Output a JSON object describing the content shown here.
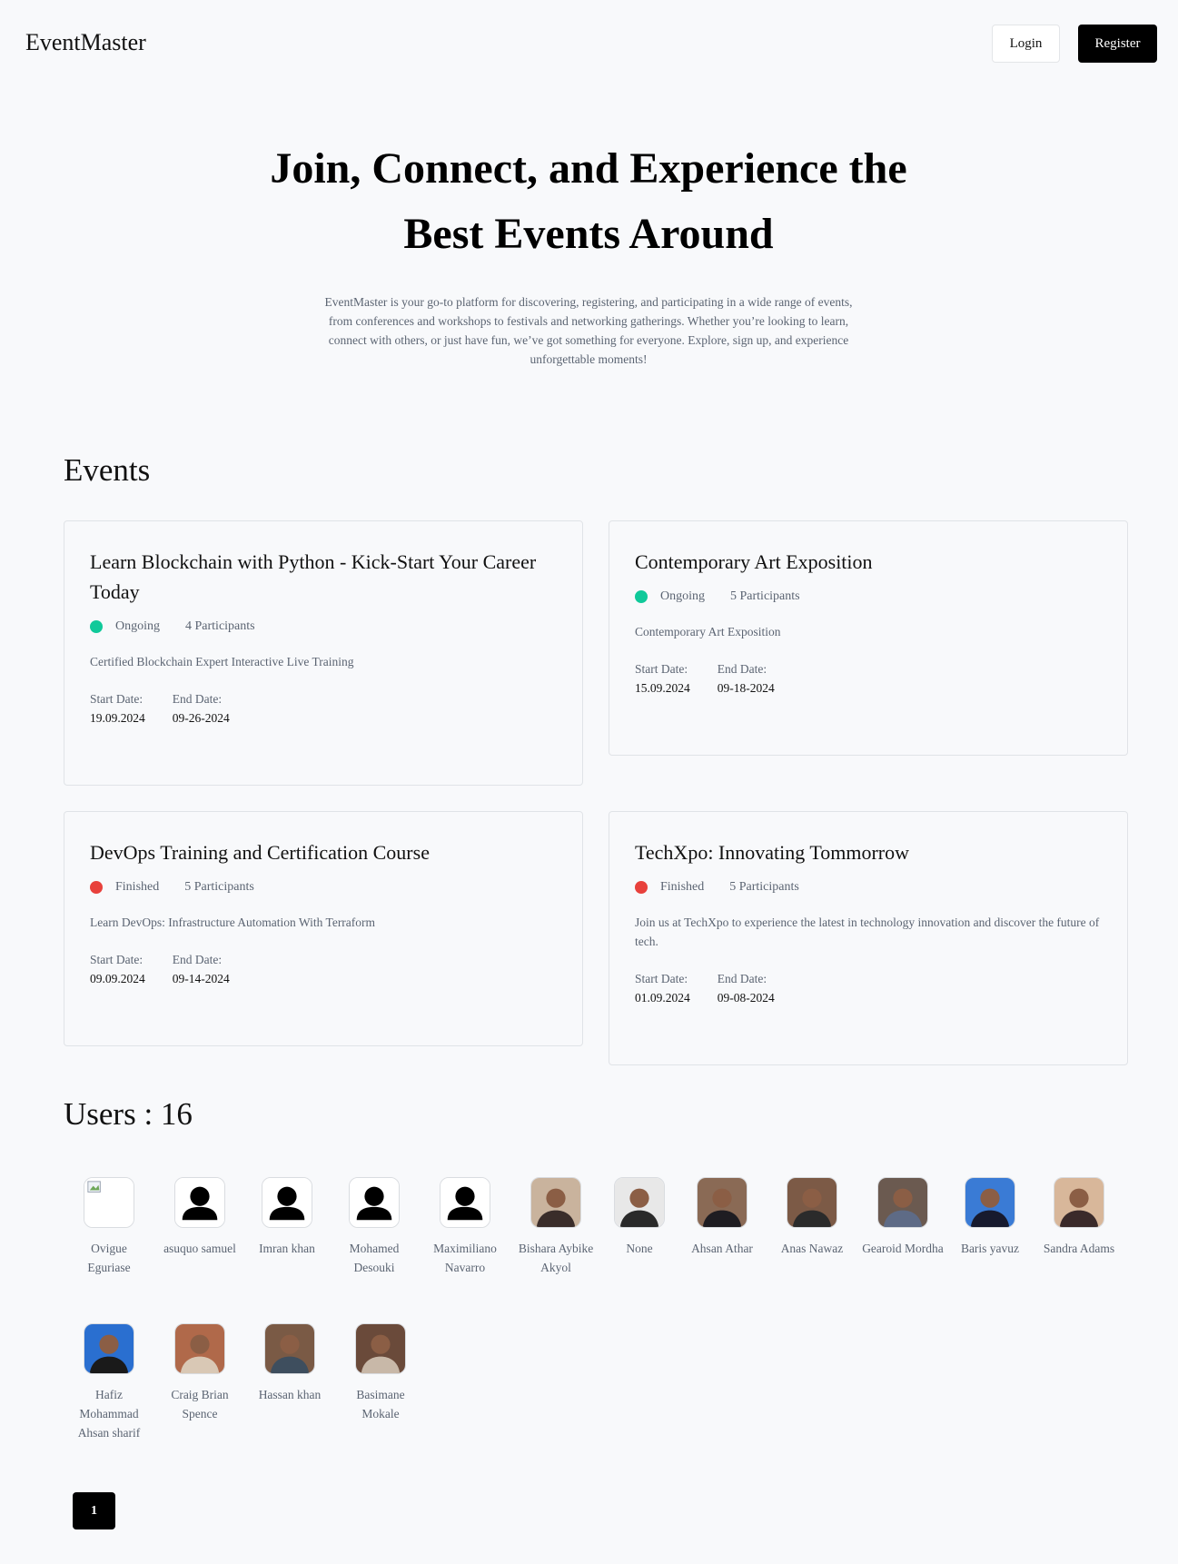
{
  "header": {
    "logo": "EventMaster",
    "login_label": "Login",
    "register_label": "Register"
  },
  "hero": {
    "title_line1": "Join, Connect, and Experience the",
    "title_line2": "Best Events Around",
    "description": "EventMaster is your go-to platform for discovering, registering, and participating in a wide range of events, from conferences and workshops to festivals and networking gatherings. Whether you’re looking to learn, connect with others, or just have fun, we’ve got something for everyone. Explore, sign up, and experience unforgettable moments!"
  },
  "events": {
    "heading": "Events",
    "start_label": "Start Date:",
    "end_label": "End Date:",
    "items": [
      {
        "title": "Learn Blockchain with Python - Kick-Start Your Career Today",
        "status": "Ongoing",
        "status_color": "#10c99a",
        "participants": "4 Participants",
        "description": "Certified Blockchain Expert Interactive Live Training",
        "start_date": "19.09.2024",
        "end_date": "09-26-2024"
      },
      {
        "title": "Contemporary Art Exposition",
        "status": "Ongoing",
        "status_color": "#10c99a",
        "participants": "5 Participants",
        "description": "Contemporary Art Exposition",
        "start_date": "15.09.2024",
        "end_date": "09-18-2024"
      },
      {
        "title": "DevOps Training and Certification Course",
        "status": "Finished",
        "status_color": "#e8413c",
        "participants": "5 Participants",
        "description": "Learn DevOps: Infrastructure Automation With Terraform",
        "start_date": "09.09.2024",
        "end_date": "09-14-2024"
      },
      {
        "title": "TechXpo: Innovating Tommorrow",
        "status": "Finished",
        "status_color": "#e8413c",
        "participants": "5 Participants",
        "description": "Join us at TechXpo to experience the latest in technology innovation and discover the future of tech.",
        "start_date": "01.09.2024",
        "end_date": "09-08-2024"
      }
    ]
  },
  "users": {
    "heading": "Users : 16",
    "items": [
      {
        "name": "Ovigue Eguriase",
        "avatar": "broken-image-icon"
      },
      {
        "name": "asuquo samuel",
        "avatar": "default-user-icon"
      },
      {
        "name": "Imran khan",
        "avatar": "default-user-icon"
      },
      {
        "name": "Mohamed Desouki",
        "avatar": "default-user-icon"
      },
      {
        "name": "Maximiliano Navarro",
        "avatar": "default-user-icon"
      },
      {
        "name": "Bishara Aybike Akyol",
        "avatar": "user-photo"
      },
      {
        "name": "None",
        "avatar": "user-photo"
      },
      {
        "name": "Ahsan Athar",
        "avatar": "user-photo"
      },
      {
        "name": "Anas Nawaz",
        "avatar": "user-photo"
      },
      {
        "name": "Gearoid Mordha",
        "avatar": "user-photo"
      },
      {
        "name": "Baris yavuz",
        "avatar": "user-photo"
      },
      {
        "name": "Sandra Adams",
        "avatar": "user-photo"
      },
      {
        "name": "Hafiz Mohammad Ahsan sharif",
        "avatar": "user-photo"
      },
      {
        "name": "Craig Brian Spence",
        "avatar": "user-photo"
      },
      {
        "name": "Hassan khan",
        "avatar": "user-photo"
      },
      {
        "name": "Basimane Mokale",
        "avatar": "user-photo"
      }
    ]
  },
  "pagination": {
    "current_page": "1"
  }
}
